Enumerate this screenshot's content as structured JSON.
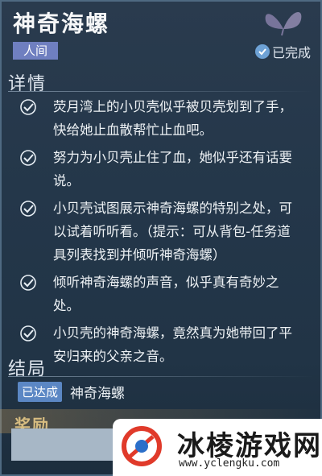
{
  "quest": {
    "title": "神奇海螺",
    "category": "人间",
    "status": "已完成"
  },
  "details": {
    "heading": "详情",
    "tasks": [
      {
        "text": "荧月湾上的小贝壳似乎被贝壳划到了手，快给她止血散帮忙止血吧。"
      },
      {
        "text": "努力为小贝壳止住了血，她似乎还有话要说。"
      },
      {
        "text": "小贝壳试图展示神奇海螺的特别之处，可以试着听听看。（提示：可从背包-任务道具列表找到并倾听神奇海螺）"
      },
      {
        "text": "倾听神奇海螺的声音，似乎真有奇妙之处。"
      },
      {
        "text": "小贝壳的神奇海螺，竟然真为她带回了平安归来的父亲之音。"
      }
    ]
  },
  "ending": {
    "heading": "结局",
    "badge": "已达成",
    "name": "神奇海螺"
  },
  "reward": {
    "heading": "奖励"
  },
  "watermark": {
    "name": "冰棱游戏网",
    "url": "www.yclengku.com"
  },
  "colors": {
    "accent": "#6f7fc0",
    "badge": "#5b87c4",
    "status_check": "#6ea2d6",
    "background": "#24374a"
  }
}
